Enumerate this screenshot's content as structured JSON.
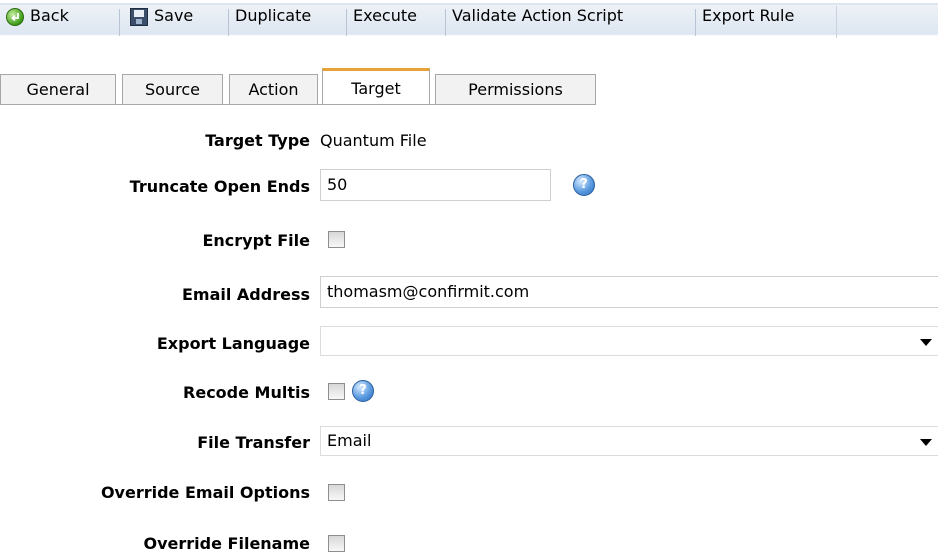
{
  "toolbar": {
    "back": "Back",
    "save": "Save",
    "duplicate": "Duplicate",
    "execute": "Execute",
    "validate": "Validate Action Script",
    "export_rule": "Export Rule"
  },
  "tabs": {
    "general": "General",
    "source": "Source",
    "action": "Action",
    "target": "Target",
    "permissions": "Permissions"
  },
  "form": {
    "target_type_label": "Target Type",
    "target_type_value": "Quantum File",
    "truncate_label": "Truncate Open Ends",
    "truncate_value": "50",
    "encrypt_label": "Encrypt File",
    "email_label": "Email Address",
    "email_value": "thomasm@confirmit.com",
    "export_language_label": "Export Language",
    "export_language_value": "",
    "recode_label": "Recode Multis",
    "file_transfer_label": "File Transfer",
    "file_transfer_value": "Email",
    "override_email_label": "Override Email Options",
    "override_filename_label": "Override Filename",
    "help_glyph": "?"
  }
}
